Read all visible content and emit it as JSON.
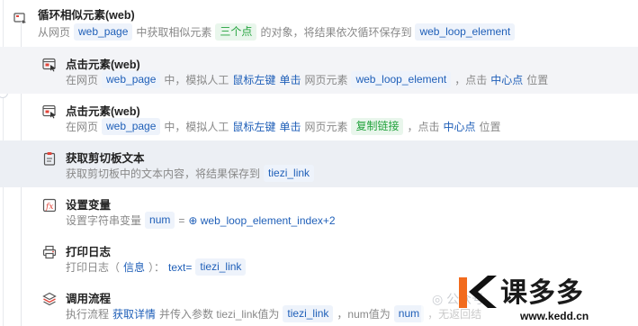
{
  "loop": {
    "title": "循环相似元素(web)",
    "desc_prefix": "从网页",
    "page_var": "web_page",
    "desc_mid": "中获取相似元素",
    "count_tag": "三个点",
    "desc_suffix": "的对象，将结果依次循环保存到",
    "result_var": "web_loop_element"
  },
  "steps": [
    {
      "icon": "click-element-icon",
      "title": "点击元素(web)",
      "parts": [
        {
          "t": "text",
          "v": "在网页"
        },
        {
          "t": "tag",
          "v": "web_page"
        },
        {
          "t": "text",
          "v": "中，模拟人工"
        },
        {
          "t": "blue",
          "v": "鼠标左键"
        },
        {
          "t": "blue",
          "v": "单击"
        },
        {
          "t": "text",
          "v": "网页元素"
        },
        {
          "t": "tag",
          "v": "web_loop_element"
        },
        {
          "t": "text",
          "v": "，点击"
        },
        {
          "t": "blue",
          "v": "中心点"
        },
        {
          "t": "text",
          "v": "位置"
        }
      ]
    },
    {
      "icon": "click-element-icon",
      "title": "点击元素(web)",
      "parts": [
        {
          "t": "text",
          "v": "在网页"
        },
        {
          "t": "tag",
          "v": "web_page"
        },
        {
          "t": "text",
          "v": "中，模拟人工"
        },
        {
          "t": "blue",
          "v": "鼠标左键"
        },
        {
          "t": "blue",
          "v": "单击"
        },
        {
          "t": "text",
          "v": "网页元素"
        },
        {
          "t": "green",
          "v": "复制链接"
        },
        {
          "t": "text",
          "v": "，点击"
        },
        {
          "t": "blue",
          "v": "中心点"
        },
        {
          "t": "text",
          "v": "位置"
        }
      ]
    },
    {
      "icon": "clipboard-icon",
      "title": "获取剪切板文本",
      "parts": [
        {
          "t": "text",
          "v": "获取剪切板中的文本内容，将结果保存到"
        },
        {
          "t": "tag",
          "v": "tiezi_link"
        }
      ]
    },
    {
      "icon": "variable-icon",
      "title": "设置变量",
      "parts": [
        {
          "t": "text",
          "v": "设置字符串变量"
        },
        {
          "t": "tag",
          "v": "num"
        },
        {
          "t": "text",
          "v": "="
        },
        {
          "t": "blue",
          "v": "⊕ web_loop_element_index+2"
        }
      ]
    },
    {
      "icon": "printer-icon",
      "title": "打印日志",
      "parts": [
        {
          "t": "text",
          "v": "打印日志（"
        },
        {
          "t": "blue",
          "v": "信息"
        },
        {
          "t": "text",
          "v": "）："
        },
        {
          "t": "blue",
          "v": "text="
        },
        {
          "t": "tag",
          "v": "tiezi_link"
        }
      ]
    },
    {
      "icon": "call-flow-icon",
      "title": "调用流程",
      "parts": [
        {
          "t": "text",
          "v": "执行流程"
        },
        {
          "t": "blue",
          "v": "获取详情"
        },
        {
          "t": "text",
          "v": "并传入参数 tiezi_link值为"
        },
        {
          "t": "tag",
          "v": "tiezi_link"
        },
        {
          "t": "text",
          "v": "，num值为"
        },
        {
          "t": "tag",
          "v": "num"
        },
        {
          "t": "text",
          "v": "，无返回结"
        }
      ]
    }
  ],
  "watermark": {
    "brand": "课多多",
    "url": "www.kedd.cn",
    "wechat_hint": "公众号"
  },
  "colors": {
    "tag_bg": "#eef3fb",
    "tag_text": "#1f5fb8",
    "green_text": "#23a33d",
    "highlight_row": "#f3f4f7",
    "brand_orange": "#f26b1d"
  }
}
